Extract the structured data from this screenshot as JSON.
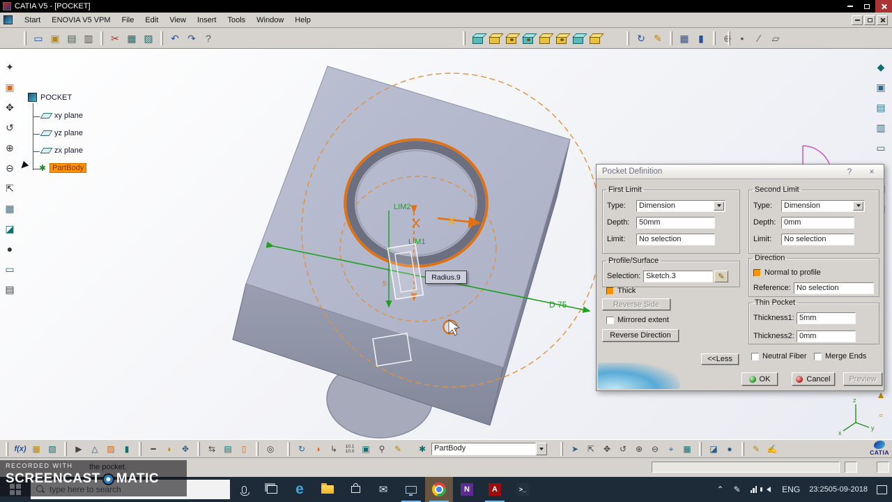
{
  "titlebar": {
    "title": "CATIA V5 - [POCKET]"
  },
  "menubar": {
    "items": [
      "Start",
      "ENOVIA V5 VPM",
      "File",
      "Edit",
      "View",
      "Insert",
      "Tools",
      "Window",
      "Help"
    ]
  },
  "tree": {
    "root": "POCKET",
    "planes": [
      "xy plane",
      "yz plane",
      "zx plane"
    ],
    "partbody": "PartBody"
  },
  "viewport": {
    "lim1": "LIM1",
    "lim2": "LIM2",
    "dim_diameter": "D 75",
    "dim_thickness1": "5",
    "dim_thickness2": "5",
    "tooltip": "Radius.9",
    "compass_axis": "y",
    "triad": [
      "z",
      "x",
      "y"
    ]
  },
  "dialog": {
    "title": "Pocket Definition",
    "help_glyph": "?",
    "close_glyph": "×",
    "first_limit": {
      "legend": "First Limit",
      "type_label": "Type:",
      "type_value": "Dimension",
      "depth_label": "Depth:",
      "depth_value": "50mm",
      "limit_label": "Limit:",
      "limit_value": "No selection"
    },
    "second_limit": {
      "legend": "Second Limit",
      "type_label": "Type:",
      "type_value": "Dimension",
      "depth_label": "Depth:",
      "depth_value": "0mm",
      "limit_label": "Limit:",
      "limit_value": "No selection"
    },
    "profile": {
      "legend": "Profile/Surface",
      "selection_label": "Selection:",
      "selection_value": "Sketch.3"
    },
    "direction": {
      "legend": "Direction",
      "normal_label": "Normal to profile",
      "reference_label": "Reference:",
      "reference_value": "No selection"
    },
    "thin_pocket": {
      "legend": "Thin Pocket",
      "t1_label": "Thickness1:",
      "t1_value": "5mm",
      "t2_label": "Thickness2:",
      "t2_value": "0mm"
    },
    "thick_label": "Thick",
    "mirrored_label": "Mirrored extent",
    "reverse_side_label": "Reverse Side",
    "reverse_direction_label": "Reverse Direction",
    "less_label": "<<Less",
    "neutral_fiber_label": "Neutral Fiber",
    "merge_ends_label": "Merge Ends",
    "ok_label": "OK",
    "cancel_label": "Cancel",
    "preview_label": "Preview"
  },
  "bottom_toolbar": {
    "fx": "f(x)",
    "measure_top": "10.1",
    "measure_bottom": "10.0",
    "partbody_combo": "PartBody",
    "brand": "CATIA"
  },
  "statusbar": {
    "message": "the pocket."
  },
  "watermark": {
    "recorded": "RECORDED WITH",
    "brand_left": "SCREENCAST",
    "brand_right": "MATIC"
  },
  "taskbar": {
    "search_placeholder": "type here to search",
    "lang": "ENG",
    "time": "23:25",
    "date": "05-09-2018"
  },
  "colors": {
    "selection_orange": "#ff9400",
    "construction_orange": "#e2700f",
    "dimension_green": "#1ea01e"
  }
}
